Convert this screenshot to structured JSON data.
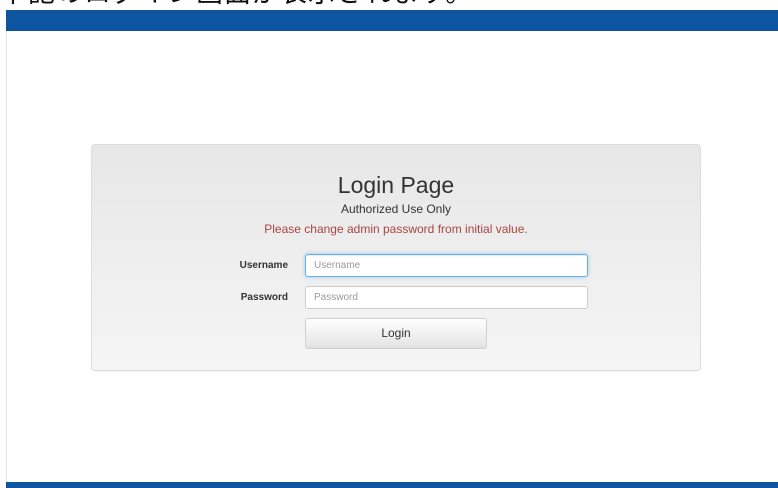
{
  "caption": {
    "text": "下記のログイン画面が表示されます。"
  },
  "login": {
    "title": "Login Page",
    "subtitle": "Authorized Use Only",
    "warning": "Please change admin password from initial value.",
    "username_label": "Username",
    "username_placeholder": "Username",
    "username_value": "",
    "password_label": "Password",
    "password_placeholder": "Password",
    "password_value": "",
    "login_button_label": "Login"
  },
  "colors": {
    "header_bar": "#0d55a0",
    "warning_text": "#a94442",
    "focus_ring": "#66afe9"
  }
}
